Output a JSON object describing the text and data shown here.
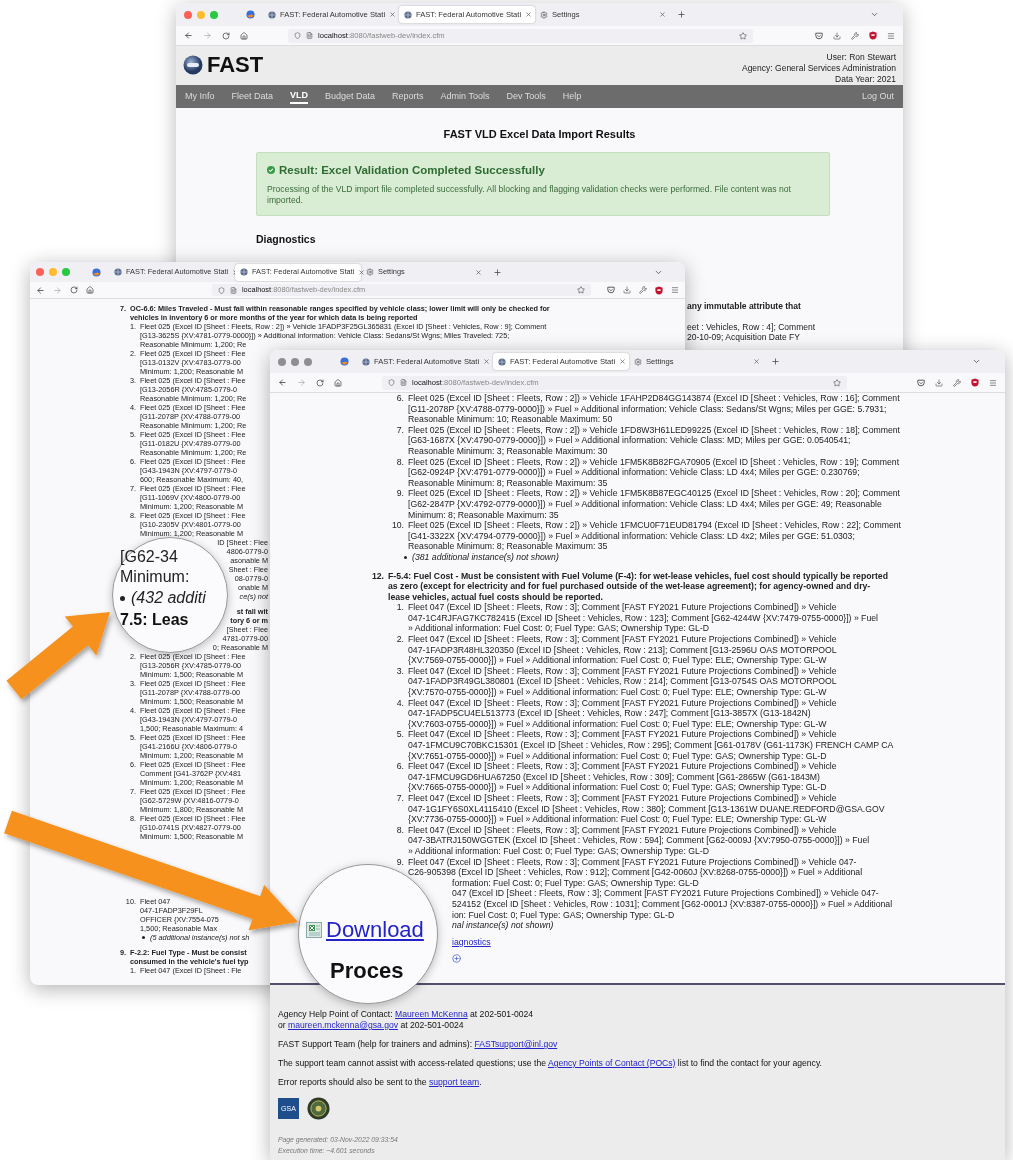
{
  "back_window": {
    "browser": {
      "active": true,
      "tabs": [
        {
          "kind": "page",
          "label": "FAST: Federal Automotive Stati",
          "selected": false
        },
        {
          "kind": "page",
          "label": "FAST: Federal Automotive Stati",
          "selected": true
        },
        {
          "kind": "settings",
          "label": "Settings",
          "selected": false
        }
      ],
      "url": {
        "host": "localhost",
        "path": ":8080/fastweb-dev/index.cfm"
      }
    },
    "header": {
      "logo": "FAST",
      "user_lines": [
        "User: Ron Stewart",
        "Agency: General Services Administration",
        "Data Year: 2021"
      ]
    },
    "nav": [
      {
        "label": "My Info",
        "selected": false
      },
      {
        "label": "Fleet Data",
        "selected": false
      },
      {
        "label": "VLD",
        "selected": true
      },
      {
        "label": "Budget Data",
        "selected": false
      },
      {
        "label": "Reports",
        "selected": false
      },
      {
        "label": "Admin Tools",
        "selected": false
      },
      {
        "label": "Dev Tools",
        "selected": false
      },
      {
        "label": "Help",
        "selected": false
      }
    ],
    "logout": "Log Out",
    "title": "FAST VLD Excel Data Import Results",
    "alert": {
      "title": "Result: Excel Validation Completed Successfully",
      "body": "Processing of the VLD import file completed successfully. All blocking and flagging validation checks were performed. File content was not imported."
    },
    "section": "Diagnostics",
    "fragments": [
      {
        "kind": "heading",
        "text": "any immutable attribute that"
      },
      {
        "kind": "text",
        "text": "eet : Vehicles, Row : 4]; Comment"
      },
      {
        "kind": "text",
        "text": "20-10-09; Acquisition Date FY"
      }
    ]
  },
  "left_window": {
    "browser": {
      "active": true,
      "tabs": [
        {
          "kind": "page",
          "label": "FAST: Federal Automotive Stati",
          "selected": false
        },
        {
          "kind": "page",
          "label": "FAST: Federal Automotive Stati",
          "selected": true
        },
        {
          "kind": "settings",
          "label": "Settings",
          "selected": false
        }
      ],
      "url": {
        "host": "localhost",
        "path": ":8080/fastweb-dev/index.cfm"
      }
    },
    "lines_above_arrow": [
      {
        "kind": "heading",
        "num": "7.",
        "text": "OC-6.6: Miles Traveled - Must fall within reasonable ranges specified by vehicle class; lower limit will only be checked for"
      },
      {
        "kind": "heading_cont",
        "text": "vehicles in inventory 6 or more months of the year for which data is being reported"
      },
      {
        "kind": "item",
        "num": "1.",
        "text": "Fleet 025 (Excel ID [Sheet : Fleets, Row : 2]) » Vehicle 1FADP3F25GL365831 (Excel ID [Sheet : Vehicles, Row : 9]; Comment"
      },
      {
        "kind": "cont",
        "text": "[G13-3625S {XV:4781-0779-0000}]) » Additional information: Vehicle Class: Sedans/St Wgns; Miles Traveled: 725;"
      },
      {
        "kind": "cont",
        "text": "Reasonable Minimum: 1,200; Re"
      },
      {
        "kind": "item",
        "num": "2.",
        "text": "Fleet 025 (Excel ID [Sheet : Flee"
      },
      {
        "kind": "cont",
        "text": "[G13-0132V {XV:4783-0779-00"
      },
      {
        "kind": "cont",
        "text": "Minimum: 1,200; Reasonable M"
      },
      {
        "kind": "item",
        "num": "3.",
        "text": "Fleet 025 (Excel ID [Sheet : Flee"
      },
      {
        "kind": "cont",
        "text": "[G13-2056R {XV:4785-0779-0"
      },
      {
        "kind": "cont",
        "text": "Reasonable Minimum: 1,200; Re"
      },
      {
        "kind": "item",
        "num": "4.",
        "text": "Fleet 025 (Excel ID [Sheet : Flee"
      },
      {
        "kind": "cont",
        "text": "[G11-2078P {XV:4788-0779-00"
      },
      {
        "kind": "cont",
        "text": "Reasonable Minimum: 1,200; Re"
      },
      {
        "kind": "item",
        "num": "5.",
        "text": "Fleet 025 (Excel ID [Sheet : Flee"
      },
      {
        "kind": "cont",
        "text": "[G11-0182U {XV:4789-0779-00"
      },
      {
        "kind": "cont",
        "text": "Reasonable Minimum: 1,200; Re"
      },
      {
        "kind": "item",
        "num": "6.",
        "text": "Fleet 025 (Excel ID [Sheet : Flee"
      },
      {
        "kind": "cont",
        "text": "[G43-1943N {XV:4797-0779-0"
      },
      {
        "kind": "cont",
        "text": "600; Reasonable Maximum: 40,"
      },
      {
        "kind": "item",
        "num": "7.",
        "text": "Fleet 025 (Excel ID [Sheet : Flee"
      },
      {
        "kind": "cont",
        "text": "[G11-1069V {XV:4800-0779-00"
      },
      {
        "kind": "cont",
        "text": "Minimum: 1,200; Reasonable M"
      },
      {
        "kind": "item",
        "num": "8.",
        "text": "Fleet 025 (Excel ID [Sheet : Flee"
      },
      {
        "kind": "cont",
        "text": "[G10-2305V {XV:4801-0779-00"
      },
      {
        "kind": "cont",
        "text": "Minimum: 1,200; Reasonable M"
      },
      {
        "kind": "frag",
        "text": "ID [Sheet : Flee"
      },
      {
        "kind": "frag",
        "text": "4806-0779-0"
      },
      {
        "kind": "frag",
        "text": "asonable M"
      },
      {
        "kind": "frag",
        "text": "Sheet : Flee"
      },
      {
        "kind": "frag",
        "text": "08-0779-0"
      },
      {
        "kind": "frag",
        "text": "onable M"
      },
      {
        "kind": "frag_note",
        "text": "ce(s) not"
      },
      {
        "kind": "frag_heading",
        "text": "st fall wit"
      },
      {
        "kind": "frag_heading",
        "text": "tory 6 or m"
      },
      {
        "kind": "frag",
        "text": "[Sheet : Flee"
      },
      {
        "kind": "frag",
        "text": "4781-0779-00"
      },
      {
        "kind": "frag",
        "text": "0; Reasonable M"
      },
      {
        "kind": "item",
        "num": "2.",
        "text": "Fleet 025 (Excel ID [Sheet : Flee"
      },
      {
        "kind": "cont",
        "text": "[G13-2056R {XV:4785-0779-00"
      },
      {
        "kind": "cont",
        "text": "Minimum: 1,500; Reasonable M"
      },
      {
        "kind": "item",
        "num": "3.",
        "text": "Fleet 025 (Excel ID [Sheet : Flee"
      },
      {
        "kind": "cont",
        "text": "[G11-2078P {XV:4788-0779-00"
      },
      {
        "kind": "cont",
        "text": "Minimum: 1,500; Reasonable M"
      },
      {
        "kind": "item",
        "num": "4.",
        "text": "Fleet 025 (Excel ID [Sheet : Flee"
      },
      {
        "kind": "cont",
        "text": "[G43-1943N {XV:4797-0779-0"
      },
      {
        "kind": "cont",
        "text": "1,500; Reasonable Maximum: 4"
      },
      {
        "kind": "item",
        "num": "5.",
        "text": "Fleet 025 (Excel ID [Sheet : Flee"
      },
      {
        "kind": "cont",
        "text": "[G41-2166U {XV:4806-0779-0"
      },
      {
        "kind": "cont",
        "text": "Minimum: 1,200; Reasonable M"
      },
      {
        "kind": "item",
        "num": "6.",
        "text": "Fleet 025 (Excel ID [Sheet : Flee"
      },
      {
        "kind": "cont",
        "text": "Comment [G41-3762P {XV:481"
      },
      {
        "kind": "cont",
        "text": "Minimum: 1,200; Reasonable M"
      },
      {
        "kind": "item",
        "num": "7.",
        "text": "Fleet 025 (Excel ID [Sheet : Flee"
      },
      {
        "kind": "cont",
        "text": "[G62-5729W {XV:4816-0779-0"
      },
      {
        "kind": "cont",
        "text": "Minimum: 1,800; Reasonable M"
      },
      {
        "kind": "item",
        "num": "8.",
        "text": "Fleet 025 (Excel ID [Sheet : Flee"
      },
      {
        "kind": "cont",
        "text": "[G10-0741S {XV:4827-0779-00"
      },
      {
        "kind": "cont",
        "text": "Minimum: 1,500; Reasonable M"
      }
    ],
    "lines_below_arrow": [
      {
        "kind": "item",
        "num": "10.",
        "text": "Fleet 047"
      },
      {
        "kind": "cont",
        "text": "047-1FADP3F29FL"
      },
      {
        "kind": "cont",
        "text": "OFFICER {XV:7554-075"
      },
      {
        "kind": "cont",
        "text": "1,500; Reasonable Max"
      },
      {
        "kind": "note",
        "text": "(5 additional instance(s) not sh"
      },
      {
        "kind": "heading",
        "num": "9.",
        "text": "F-2.2: Fuel Type - Must be consist"
      },
      {
        "kind": "heading_cont",
        "text": "consumed in the vehicle's fuel typ"
      },
      {
        "kind": "item",
        "num": "1.",
        "text": "Fleet 047 (Excel ID [Sheet : Fle"
      }
    ],
    "magnifier": [
      {
        "kind": "text",
        "text": "[G62-34"
      },
      {
        "kind": "text",
        "text": "Minimum:"
      },
      {
        "kind": "note",
        "text": "(432 additi"
      },
      {
        "kind": "heading",
        "text": "7.5: Leas"
      }
    ]
  },
  "front_window": {
    "browser": {
      "active": false,
      "tabs": [
        {
          "kind": "page",
          "label": "FAST: Federal Automotive Stati",
          "selected": false
        },
        {
          "kind": "page",
          "label": "FAST: Federal Automotive Stati",
          "selected": true
        },
        {
          "kind": "settings",
          "label": "Settings",
          "selected": false
        }
      ],
      "url": {
        "host": "localhost",
        "path": ":8080/fastweb-dev/index.cfm"
      }
    },
    "lines": [
      {
        "kind": "item",
        "num": "6.",
        "text": "Fleet 025 (Excel ID [Sheet : Fleets, Row : 2]) » Vehicle 1FAHP2D84GG143874 (Excel ID [Sheet : Vehicles, Row : 16]; Comment"
      },
      {
        "kind": "cont",
        "text": "[G11-2078P {XV:4788-0779-0000}]) » Fuel » Additional information: Vehicle Class: Sedans/St Wgns; Miles per GGE: 5.7931;"
      },
      {
        "kind": "cont",
        "text": "Reasonable Minimum: 10; Reasonable Maximum: 50"
      },
      {
        "kind": "item",
        "num": "7.",
        "text": "Fleet 025 (Excel ID [Sheet : Fleets, Row : 2]) » Vehicle 1FD8W3H61LED99225 (Excel ID [Sheet : Vehicles, Row : 18]; Comment"
      },
      {
        "kind": "cont",
        "text": "[G63-1687X {XV:4790-0779-0000}]) » Fuel » Additional information: Vehicle Class: MD; Miles per GGE: 0.0540541;"
      },
      {
        "kind": "cont",
        "text": "Reasonable Minimum: 3; Reasonable Maximum: 30"
      },
      {
        "kind": "item",
        "num": "8.",
        "text": "Fleet 025 (Excel ID [Sheet : Fleets, Row : 2]) » Vehicle 1FM5K8B82FGA70905 (Excel ID [Sheet : Vehicles, Row : 19]; Comment"
      },
      {
        "kind": "cont",
        "text": "[G62-0924P {XV:4791-0779-0000}]) » Fuel » Additional information: Vehicle Class: LD 4x4; Miles per GGE: 0.230769;"
      },
      {
        "kind": "cont",
        "text": "Reasonable Minimum: 8; Reasonable Maximum: 35"
      },
      {
        "kind": "item",
        "num": "9.",
        "text": "Fleet 025 (Excel ID [Sheet : Fleets, Row : 2]) » Vehicle 1FM5K8B87EGC40125 (Excel ID [Sheet : Vehicles, Row : 20]; Comment"
      },
      {
        "kind": "cont",
        "text": "[G62-2847P {XV:4792-0779-0000}]) » Fuel » Additional information: Vehicle Class: LD 4x4; Miles per GGE: 49; Reasonable"
      },
      {
        "kind": "cont",
        "text": "Minimum: 8; Reasonable Maximum: 35"
      },
      {
        "kind": "item",
        "num": "10.",
        "text": "Fleet 025 (Excel ID [Sheet : Fleets, Row : 2]) » Vehicle 1FMCU0F71EUD81794 (Excel ID [Sheet : Vehicles, Row : 22]; Comment"
      },
      {
        "kind": "cont",
        "text": "[G41-3322X {XV:4794-0779-0000}]) » Fuel » Additional information: Vehicle Class: LD 4x2; Miles per GGE: 51.0303;"
      },
      {
        "kind": "cont",
        "text": "Reasonable Minimum: 8; Reasonable Maximum: 35"
      },
      {
        "kind": "note",
        "text": "(381 additional instance(s) not shown)"
      },
      {
        "kind": "heading",
        "num": "12.",
        "text": "F-5.4: Fuel Cost - Must be consistent with Fuel Volume (F-4): for wet-lease vehicles, fuel cost should typically be reported"
      },
      {
        "kind": "heading_cont",
        "text": "as zero (except for electricity and for fuel purchased outside of the wet-lease agreement); for agency-owned and dry-"
      },
      {
        "kind": "heading_cont",
        "text": "lease vehicles, actual fuel costs should be reported."
      },
      {
        "kind": "item",
        "num": "1.",
        "text": "Fleet 047 (Excel ID [Sheet : Fleets, Row : 3]; Comment [FAST FY2021 Future Projections Combined]) » Vehicle"
      },
      {
        "kind": "cont",
        "text": "047-1C4RJFAG7KC782415 (Excel ID [Sheet : Vehicles, Row : 123]; Comment [G62-4244W {XV:7479-0755-0000}]) » Fuel"
      },
      {
        "kind": "cont",
        "text": " » Additional information: Fuel Cost: 0; Fuel Type: GAS; Ownership Type: GL-D"
      },
      {
        "kind": "item",
        "num": "2.",
        "text": "Fleet 047 (Excel ID [Sheet : Fleets, Row : 3]; Comment [FAST FY2021 Future Projections Combined]) » Vehicle"
      },
      {
        "kind": "cont",
        "text": "047-1FADP3R48HL320350 (Excel ID [Sheet : Vehicles, Row : 213]; Comment [G13-2596U OAS MOTORPOOL"
      },
      {
        "kind": "cont",
        "text": "{XV:7569-0755-0000}]) » Fuel » Additional information: Fuel Cost: 0; Fuel Type: ELE; Ownership Type: GL-W"
      },
      {
        "kind": "item",
        "num": "3.",
        "text": "Fleet 047 (Excel ID [Sheet : Fleets, Row : 3]; Comment [FAST FY2021 Future Projections Combined]) » Vehicle"
      },
      {
        "kind": "cont",
        "text": "047-1FADP3R49GL380801 (Excel ID [Sheet : Vehicles, Row : 214]; Comment [G13-0754S OAS MOTORPOOL"
      },
      {
        "kind": "cont",
        "text": "{XV:7570-0755-0000}]) » Fuel » Additional information: Fuel Cost: 0; Fuel Type: ELE; Ownership Type: GL-W"
      },
      {
        "kind": "item",
        "num": "4.",
        "text": "Fleet 047 (Excel ID [Sheet : Fleets, Row : 3]; Comment [FAST FY2021 Future Projections Combined]) » Vehicle"
      },
      {
        "kind": "cont",
        "text": "047-1FADP5CU4EL513773 (Excel ID [Sheet : Vehicles, Row : 247]; Comment [G13-3857X (G13-1842N)"
      },
      {
        "kind": "cont",
        "text": "{XV:7603-0755-0000}]) » Fuel » Additional information: Fuel Cost: 0; Fuel Type: ELE; Ownership Type: GL-W"
      },
      {
        "kind": "item",
        "num": "5.",
        "text": "Fleet 047 (Excel ID [Sheet : Fleets, Row : 3]; Comment [FAST FY2021 Future Projections Combined]) » Vehicle"
      },
      {
        "kind": "cont",
        "text": "047-1FMCU9C70BKC15301 (Excel ID [Sheet : Vehicles, Row : 295]; Comment [G61-0178V (G61-1173K) FRENCH CAMP CA"
      },
      {
        "kind": "cont",
        "text": "{XV:7651-0755-0000}]) » Fuel » Additional information: Fuel Cost: 0; Fuel Type: GAS; Ownership Type: GL-D"
      },
      {
        "kind": "item",
        "num": "6.",
        "text": "Fleet 047 (Excel ID [Sheet : Fleets, Row : 3]; Comment [FAST FY2021 Future Projections Combined]) » Vehicle"
      },
      {
        "kind": "cont",
        "text": "047-1FMCU9GD6HUA67250 (Excel ID [Sheet : Vehicles, Row : 309]; Comment [G61-2865W (G61-1843M)"
      },
      {
        "kind": "cont",
        "text": "{XV:7665-0755-0000}]) » Fuel » Additional information: Fuel Cost: 0; Fuel Type: GAS; Ownership Type: GL-D"
      },
      {
        "kind": "item",
        "num": "7.",
        "text": "Fleet 047 (Excel ID [Sheet : Fleets, Row : 3]; Comment [FAST FY2021 Future Projections Combined]) » Vehicle"
      },
      {
        "kind": "cont",
        "text": "047-1G1FY6S0XL4115410 (Excel ID [Sheet : Vehicles, Row : 380]; Comment [G13-1361W DUANE.REDFORD@GSA.GOV"
      },
      {
        "kind": "cont",
        "text": "{XV:7736-0755-0000}]) » Fuel » Additional information: Fuel Cost: 0; Fuel Type: ELE; Ownership Type: GL-W"
      },
      {
        "kind": "item",
        "num": "8.",
        "text": "Fleet 047 (Excel ID [Sheet : Fleets, Row : 3]; Comment [FAST FY2021 Future Projections Combined]) » Vehicle"
      },
      {
        "kind": "cont",
        "text": "047-3BATRJ150WGGTEK (Excel ID [Sheet : Vehicles, Row : 594]; Comment [G62-0009J {XV:7950-0755-0000}]) » Fuel"
      },
      {
        "kind": "cont",
        "text": " » Additional information: Fuel Cost: 0; Fuel Type: GAS; Ownership Type: GL-D"
      },
      {
        "kind": "item",
        "num": "9.",
        "text": "Fleet 047 (Excel ID [Sheet : Fleets, Row : 3]; Comment [FAST FY2021 Future Projections Combined]) » Vehicle 047-"
      },
      {
        "kind": "cont",
        "text": "C26-905398 (Excel ID [Sheet : Vehicles, Row : 912]; Comment [G42-0060J {XV:8268-0755-0000}]) » Fuel » Additional"
      },
      {
        "kind": "frag",
        "text": "formation: Fuel Cost: 0; Fuel Type: GAS; Ownership Type: GL-D"
      },
      {
        "kind": "frag",
        "text": "047 (Excel ID [Sheet : Fleets, Row : 3]; Comment [FAST FY2021 Future Projections Combined]) » Vehicle 047-"
      },
      {
        "kind": "frag",
        "text": "524152 (Excel ID [Sheet : Vehicles, Row : 1031]; Comment [G62-0001J {XV:8387-0755-0000}]) » Fuel » Additional"
      },
      {
        "kind": "frag",
        "text": "ion: Fuel Cost: 0; Fuel Type: GAS; Ownership Type: GL-D"
      },
      {
        "kind": "frag_note",
        "text": "nal instance(s) not shown)"
      }
    ],
    "download_link": "iagnostics",
    "magnifier": {
      "link": "Download",
      "heading": "Proces"
    },
    "footer": {
      "paragraphs": [
        [
          [
            {
              "text": "Agency Help Point of Contact: "
            },
            {
              "text": "Maureen McKenna",
              "link": true
            },
            {
              "text": " at 202-501-0024"
            }
          ],
          [
            {
              "text": "or "
            },
            {
              "text": "maureen.mckenna@gsa.gov",
              "link": true
            },
            {
              "text": " at 202-501-0024"
            }
          ]
        ],
        [
          [
            {
              "text": "FAST Support Team (help for trainers and admins): "
            },
            {
              "text": "FASTsupport@inl.gov",
              "link": true
            }
          ]
        ],
        [
          [
            {
              "text": "The support team cannot assist with access-related questions; use the "
            },
            {
              "text": "Agency Points of Contact (POCs)",
              "link": true
            },
            {
              "text": " list to find the contact for your agency."
            }
          ]
        ],
        [
          [
            {
              "text": "Error reports should also be sent to the "
            },
            {
              "text": "support team",
              "link": true
            },
            {
              "text": "."
            }
          ]
        ]
      ],
      "logos": [
        {
          "kind": "gsa",
          "text": "GSA"
        },
        {
          "kind": "seal"
        }
      ],
      "generated": "Page generated: 03-Nov-2022 09:33:54",
      "execution": "Execution time: ~4.601 seconds"
    }
  }
}
